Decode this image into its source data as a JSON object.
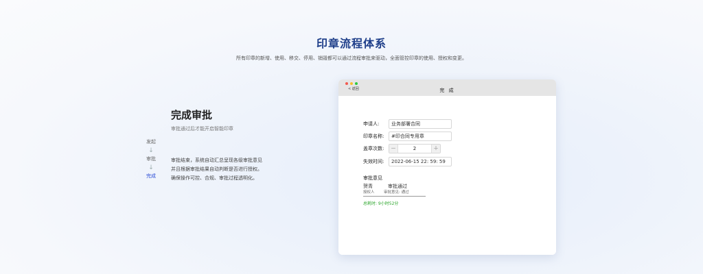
{
  "header": {
    "title": "印章流程体系",
    "subtitle": "所有印章的新增、使用、移交、停用、销毁都可以通过流程审批来驱动，全面管控印章的使用、授权和变更。"
  },
  "steps": [
    {
      "label": "发起",
      "active": false
    },
    {
      "label": "审批",
      "active": false
    },
    {
      "label": "完成",
      "active": true
    }
  ],
  "section": {
    "title": "完成审批",
    "subtitle": "审批通过后才能开启智能印章",
    "desc_lines": [
      "审批结束，系统自动汇总呈现各级审批意见",
      "并且根据审批结果自动判断是否进行授权。",
      "确保操作可控、合规、审批过程透明化。"
    ]
  },
  "window": {
    "back_label": "< 返回",
    "title": "完 成",
    "form": {
      "applicant_label": "申请人:",
      "applicant_value": "业务部署合同",
      "seal_name_label": "印章名称:",
      "seal_name_value": "#印合同专用章",
      "count_label": "盖章次数:",
      "count_value": "2",
      "minus": "－",
      "plus": "＋",
      "expire_label": "失效时间:",
      "expire_value": "2022-06-15  22:  59:  59"
    },
    "opinion": {
      "title": "审批意见",
      "approver": "贺青",
      "status": "审批通过",
      "role": "授权人",
      "opinion": "审批意见: 通过",
      "total": "总耗时:  9小时52分"
    }
  },
  "colors": {
    "accent": "#1f3f8a",
    "active_step": "#2a4bd6",
    "success": "#2aa52a"
  }
}
